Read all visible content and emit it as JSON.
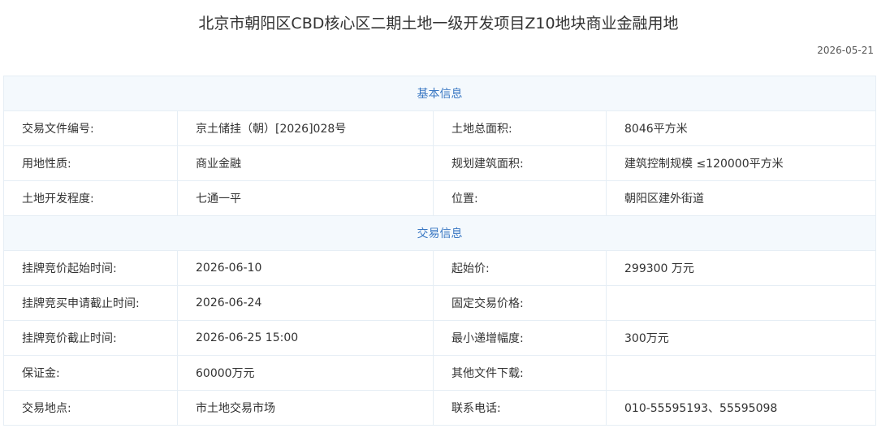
{
  "title": "北京市朝阳区CBD核心区二期土地一级开发项目Z10地块商业金融用地",
  "date": "2026-05-21",
  "sections": {
    "basic": {
      "heading": "基本信息",
      "rows": [
        [
          "交易文件编号:",
          "京土储挂（朝）[2026]028号",
          "土地总面积:",
          "8046平方米"
        ],
        [
          "用地性质:",
          "商业金融",
          "规划建筑面积:",
          "建筑控制规模 ≤120000平方米"
        ],
        [
          "土地开发程度:",
          "七通一平",
          "位置:",
          "朝阳区建外街道"
        ]
      ]
    },
    "trade": {
      "heading": "交易信息",
      "rows": [
        [
          "挂牌竞价起始时间:",
          "2026-06-10",
          "起始价:",
          "299300 万元"
        ],
        [
          "挂牌竞买申请截止时间:",
          "2026-06-24",
          "固定交易价格:",
          ""
        ],
        [
          "挂牌竞价截止时间:",
          "2026-06-25 15:00",
          "最小递增幅度:",
          "300万元"
        ],
        [
          "保证金:",
          "60000万元",
          "其他文件下载:",
          ""
        ],
        [
          "交易地点:",
          "市土地交易市场",
          "联系电话:",
          "010-55595193、55595098"
        ]
      ]
    }
  }
}
